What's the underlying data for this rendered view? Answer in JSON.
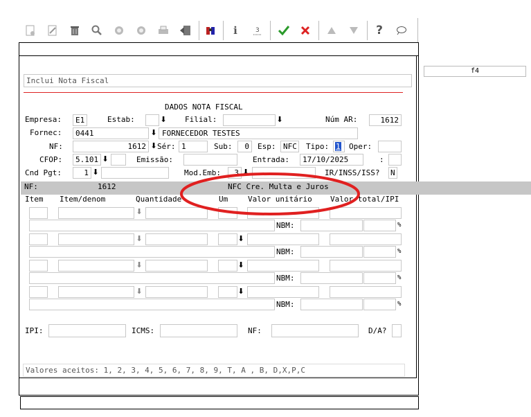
{
  "toolbar": {
    "icons": [
      "new-icon",
      "edit-icon",
      "trash-icon",
      "search-icon",
      "prev-icon",
      "next-icon",
      "print-icon",
      "exit-icon",
      "binoculars-icon",
      "info-icon",
      "underline-icon",
      "confirm-icon",
      "cancel-icon",
      "up-icon",
      "down-icon",
      "help-icon",
      "comment-icon"
    ],
    "glyphs": {
      "info": "ℹ",
      "help": "?",
      "comment": "💬"
    }
  },
  "f4_label": "f4",
  "title_field": "Inclui Nota Fiscal",
  "section_title": "DADOS NOTA FISCAL",
  "labels": {
    "empresa": "Empresa:",
    "estab": "Estab:",
    "filial": "Filial:",
    "num_ar": "Núm AR:",
    "fornec": "Fornec:",
    "nf": "NF:",
    "ser": "Sér:",
    "sub": "Sub:",
    "esp": "Esp:",
    "tipo": "Tipo:",
    "oper": "Oper:",
    "cfop": "CFOP:",
    "emissao": "Emissão:",
    "entrada": "Entrada:",
    "colon": ":",
    "cnd_pgt": "Cnd Pgt:",
    "mod_emb": "Mod.Emb:",
    "ir_inss": "IR/INSS/ISS?",
    "nbm": "NBM:",
    "pct": "%",
    "ipi": "IPI:",
    "icms": "ICMS:",
    "nf_bottom": "NF:",
    "da": "D/A?"
  },
  "values": {
    "empresa": "E1",
    "estab": "",
    "filial": "",
    "num_ar": "1612",
    "fornec_code": "0441",
    "fornec_name": "FORNECEDOR TESTES",
    "nf": "1612",
    "ser": "1",
    "sub": "0",
    "esp": "NFC",
    "tipo": "1",
    "oper": "",
    "cfop": "5.101",
    "cfop_extra": "",
    "emissao": "",
    "entrada": "17/10/2025",
    "cnd_pgt": "1",
    "mod_emb": "3",
    "ir_inss": "N"
  },
  "info_bar": {
    "nf_label": "NF:",
    "nf_value": "1612",
    "description": "NFC Cre. Multa e Juros"
  },
  "columns": [
    "Item",
    "Item/denom",
    "Quantidade",
    "Um",
    "Valor unitário",
    "Valor total/IPI"
  ],
  "status_bar": "Valores aceitos: 1, 2, 3, 4, 5, 6, 7, 8, 9, T, A , B, D,X,P,C",
  "annotation_color": "#e02020"
}
